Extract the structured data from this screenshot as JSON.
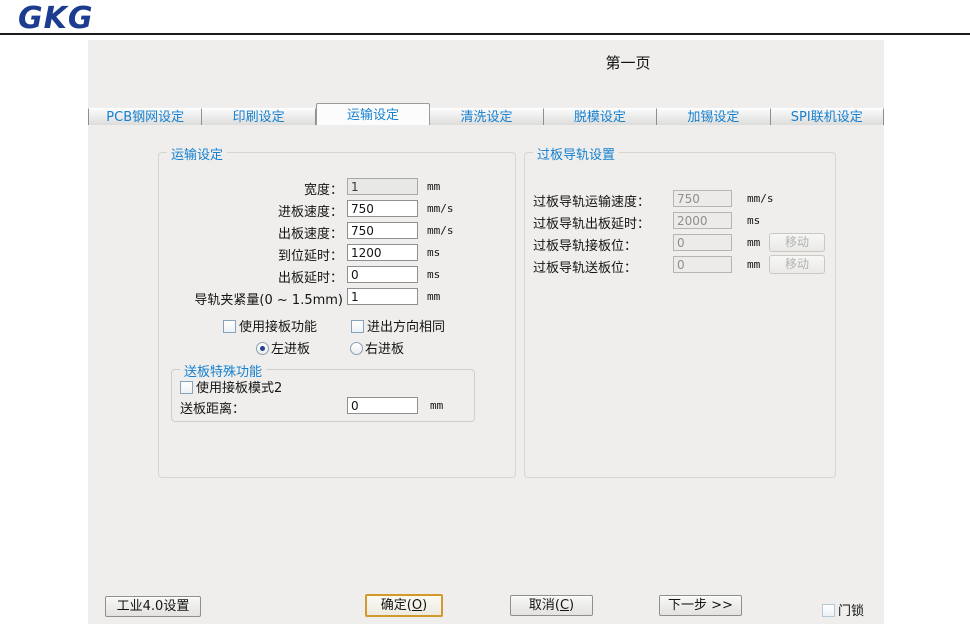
{
  "logo": "GKG",
  "page_title": "第一页",
  "tabs": [
    {
      "label": "PCB钢网设定",
      "selected": false
    },
    {
      "label": "印刷设定",
      "selected": false
    },
    {
      "label": "运输设定",
      "selected": true
    },
    {
      "label": "清洗设定",
      "selected": false
    },
    {
      "label": "脱模设定",
      "selected": false
    },
    {
      "label": "加锡设定",
      "selected": false
    },
    {
      "label": "SPI联机设定",
      "selected": false
    }
  ],
  "transport_group": {
    "title": "运输设定",
    "fields": [
      {
        "label": "宽度：",
        "value": "1",
        "unit": "mm",
        "disabled": true
      },
      {
        "label": "进板速度：",
        "value": "750",
        "unit": "mm/s",
        "disabled": false
      },
      {
        "label": "出板速度：",
        "value": "750",
        "unit": "mm/s",
        "disabled": false
      },
      {
        "label": "到位延时：",
        "value": "1200",
        "unit": "ms",
        "disabled": false
      },
      {
        "label": "出板延时：",
        "value": "0",
        "unit": "ms",
        "disabled": false
      },
      {
        "label": "导轨夹紧量(0 ~ 1.5mm)",
        "value": "1",
        "unit": "mm",
        "disabled": false
      }
    ],
    "checkboxes": [
      {
        "label": "使用接板功能",
        "checked": false
      },
      {
        "label": "进出方向相同",
        "checked": false
      }
    ],
    "radios": [
      {
        "label": "左进板",
        "checked": true
      },
      {
        "label": "右进板",
        "checked": false
      }
    ],
    "special_group": {
      "title": "送板特殊功能",
      "checkbox": {
        "label": "使用接板模式2",
        "checked": false
      },
      "field": {
        "label": "送板距离：",
        "value": "0",
        "unit": "mm"
      }
    }
  },
  "rail_group": {
    "title": "过板导轨设置",
    "fields": [
      {
        "label": "过板导轨运输速度：",
        "value": "750",
        "unit": "mm/s",
        "disabled": true
      },
      {
        "label": "过板导轨出板延时：",
        "value": "2000",
        "unit": "ms",
        "disabled": true
      },
      {
        "label": "过板导轨接板位：",
        "value": "0",
        "unit": "mm",
        "disabled": true,
        "button_label": "移动"
      },
      {
        "label": "过板导轨送板位：",
        "value": "0",
        "unit": "mm",
        "disabled": true,
        "button_label": "移动"
      }
    ]
  },
  "footer": {
    "industry_button": "工业4.0设置",
    "ok_button": {
      "pre": "确定(",
      "key": "O",
      "suf": ")"
    },
    "cancel_button": {
      "pre": "取消(",
      "key": "C",
      "suf": ")"
    },
    "next_button": "下一步 >>",
    "door_lock_label": "门锁",
    "door_lock_checked": false
  },
  "colors": {
    "accent_blue": "#1580d0",
    "logo_navy": "#1b3c8f",
    "ok_border_gold": "#d29a2c",
    "dialog_background": "#efeeec"
  }
}
